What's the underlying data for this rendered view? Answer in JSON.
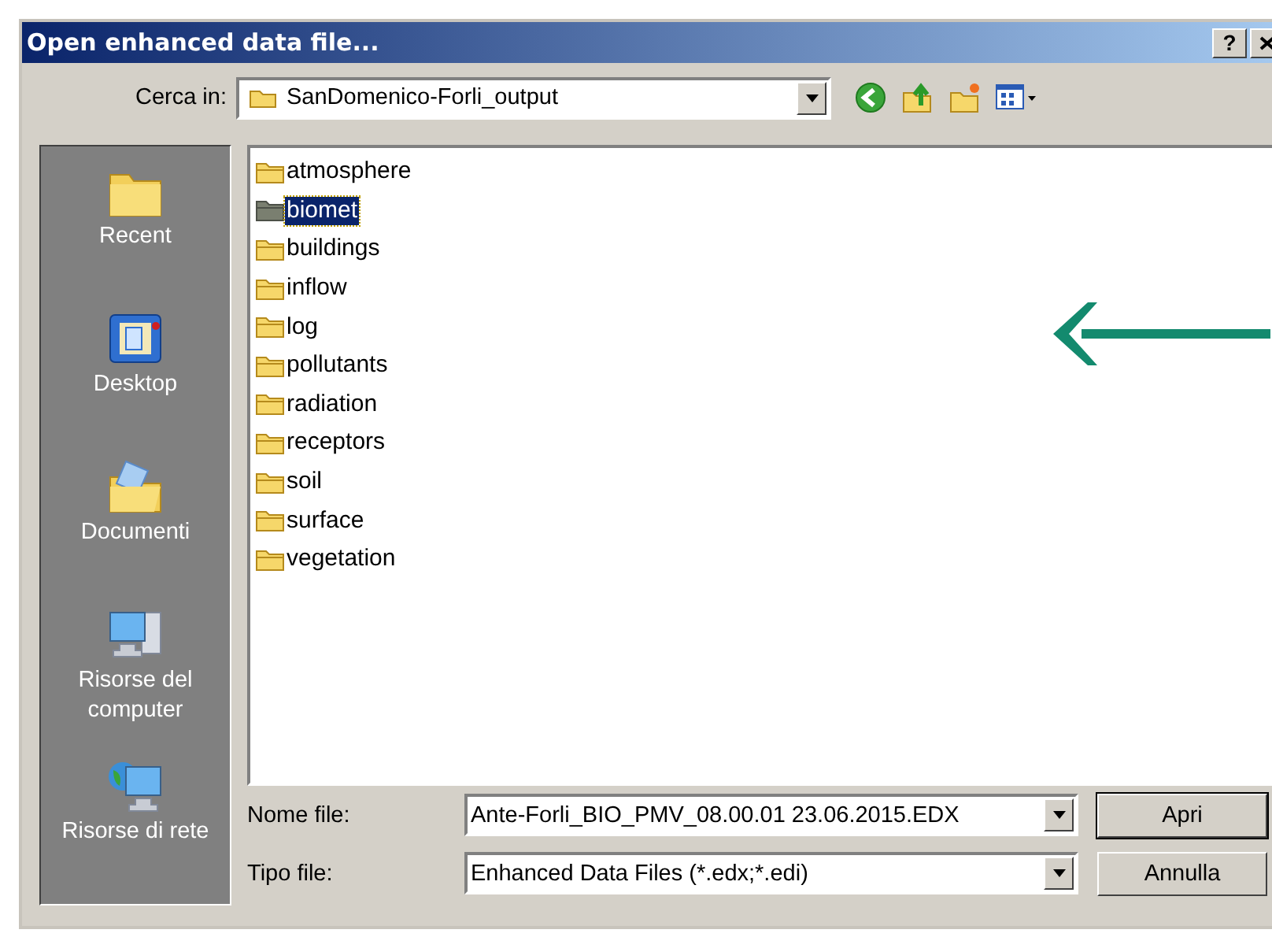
{
  "window": {
    "title": "Open enhanced data file...",
    "help": "?"
  },
  "look_in": {
    "label": "Cerca in:",
    "value": "SanDomenico-Forli_output"
  },
  "places": [
    {
      "label": "Recent",
      "kind": "recent"
    },
    {
      "label": "Desktop",
      "kind": "desktop"
    },
    {
      "label": "Documenti",
      "kind": "documents"
    },
    {
      "label": "Risorse del computer",
      "kind": "computer"
    },
    {
      "label": "Risorse di rete",
      "kind": "network"
    }
  ],
  "files": [
    {
      "name": "atmosphere",
      "selected": false
    },
    {
      "name": "biomet",
      "selected": true
    },
    {
      "name": "buildings",
      "selected": false
    },
    {
      "name": "inflow",
      "selected": false
    },
    {
      "name": "log",
      "selected": false
    },
    {
      "name": "pollutants",
      "selected": false
    },
    {
      "name": "radiation",
      "selected": false
    },
    {
      "name": "receptors",
      "selected": false
    },
    {
      "name": "soil",
      "selected": false
    },
    {
      "name": "surface",
      "selected": false
    },
    {
      "name": "vegetation",
      "selected": false
    }
  ],
  "file_name": {
    "label": "Nome file:",
    "value": "Ante-Forli_BIO_PMV_08.00.01 23.06.2015.EDX"
  },
  "file_type": {
    "label": "Tipo file:",
    "value": "Enhanced Data Files (*.edx;*.edi)"
  },
  "buttons": [
    "Apri",
    "Annulla"
  ]
}
